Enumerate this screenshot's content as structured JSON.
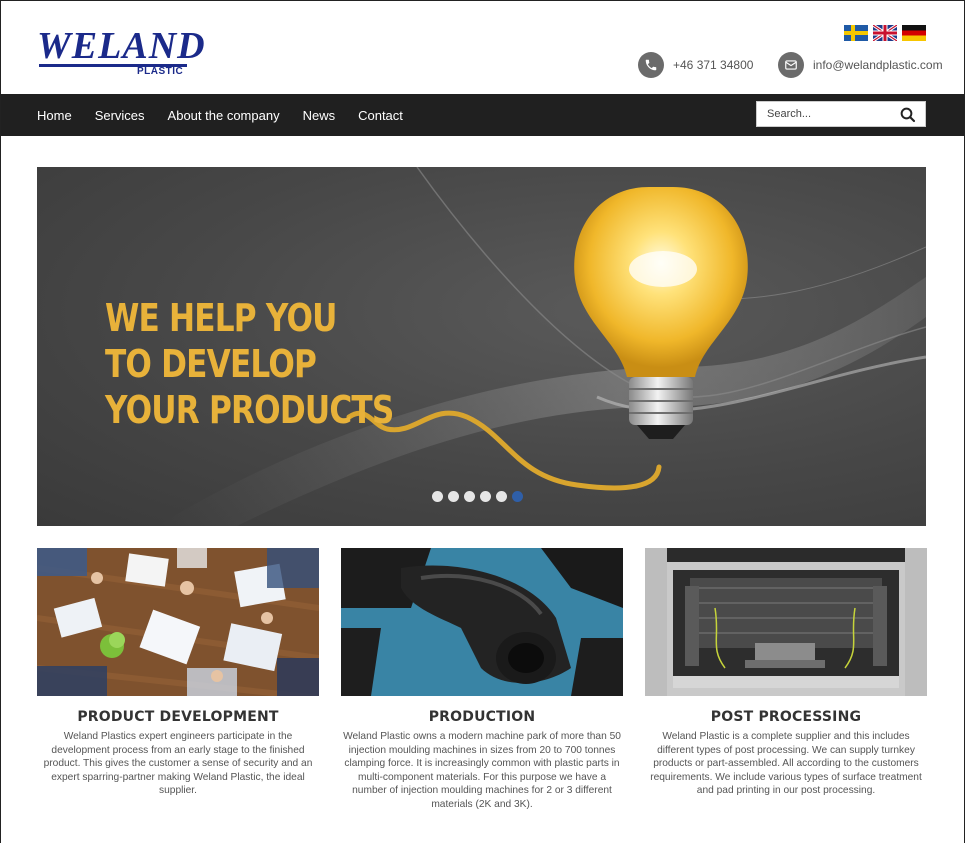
{
  "header": {
    "logo_text": "WELAND",
    "logo_sub": "PLASTIC",
    "phone": "+46 371 34800",
    "email": "info@welandplastic.com"
  },
  "languages": [
    "Swedish",
    "English",
    "German"
  ],
  "nav": {
    "items": [
      {
        "label": "Home"
      },
      {
        "label": "Services"
      },
      {
        "label": "About the company"
      },
      {
        "label": "News"
      },
      {
        "label": "Contact"
      }
    ],
    "search_placeholder": "Search..."
  },
  "hero": {
    "lines": [
      "WE HELP YOU",
      "TO DEVELOP",
      "YOUR PRODUCTS"
    ],
    "slide_count": 6,
    "active_slide": 6,
    "accent_color": "#e8b23a"
  },
  "columns": [
    {
      "title": "PRODUCT DEVELOPMENT",
      "text": "Weland Plastics expert engineers participate in the development process from an early stage to the finished product. This gives the customer a sense of security and an expert sparring-partner making Weland Plastic, the ideal supplier."
    },
    {
      "title": "PRODUCTION",
      "text": "Weland Plastic owns a modern machine park of more than 50 injection moulding machines in sizes from 20 to 700 tonnes clamping force. It is increasingly common with plastic parts in multi-component materials. For this purpose we have a number of injection moulding machines for 2 or 3 different materials (2K and 3K)."
    },
    {
      "title": "POST PROCESSING",
      "text": "Weland Plastic is a complete supplier and this includes different types of post processing. We can supply turnkey products or part-assembled. All according to the customers requirements. We include various types of surface treatment and pad printing in our post processing."
    }
  ],
  "colors": {
    "brand": "#1b2a8a",
    "nav_bg": "#202020",
    "active_dot": "#2f5fa8"
  }
}
